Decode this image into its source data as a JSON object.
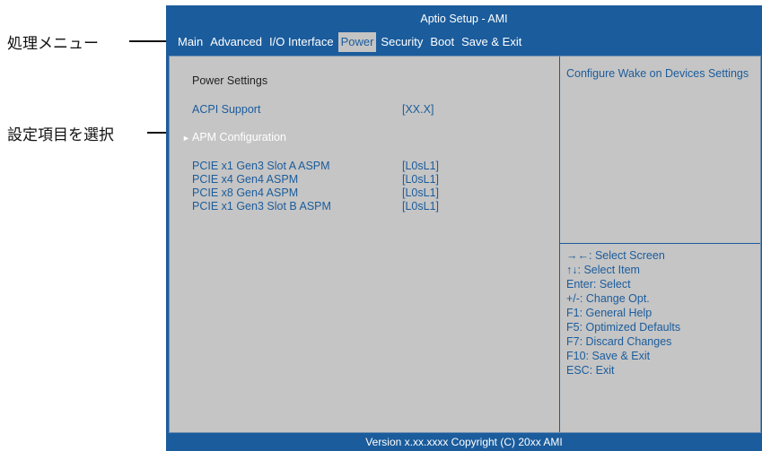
{
  "annotations": {
    "menu_label": "処理メニュー",
    "select_label": "設定項目を選択"
  },
  "window": {
    "title": "Aptio Setup - AMI"
  },
  "menu": {
    "items": [
      {
        "label": "Main"
      },
      {
        "label": "Advanced"
      },
      {
        "label": "I/O Interface"
      },
      {
        "label": "Power",
        "active": true
      },
      {
        "label": "Security"
      },
      {
        "label": "Boot"
      },
      {
        "label": "Save & Exit"
      }
    ]
  },
  "settings": {
    "heading": "Power Settings",
    "acpi": {
      "label": "ACPI Support",
      "value": "[XX.X]"
    },
    "apm": {
      "label": "APM Configuration",
      "arrow": "►"
    },
    "pcie": [
      {
        "label": "PCIE x1 Gen3 Slot A ASPM",
        "value": "[L0sL1]"
      },
      {
        "label": "PCIE x4 Gen4 ASPM",
        "value": "[L0sL1]"
      },
      {
        "label": "PCIE x8 Gen4 ASPM",
        "value": "[L0sL1]"
      },
      {
        "label": "PCIE x1 Gen3 Slot B ASPM",
        "value": "[L0sL1]"
      }
    ]
  },
  "help": {
    "text": "Configure Wake on Devices Settings",
    "keys": [
      "→←: Select Screen",
      "↑↓: Select Item",
      "Enter: Select",
      "+/-: Change Opt.",
      "F1: General Help",
      "F5: Optimized Defaults",
      "F7: Discard Changes",
      "F10: Save & Exit",
      "ESC: Exit"
    ]
  },
  "footer": {
    "text": "Version x.xx.xxxx Copyright (C) 20xx AMI"
  },
  "colors": {
    "bios_blue": "#1b5c9c",
    "panel_gray": "#c5c5c5",
    "selected_text": "#ffffff"
  }
}
